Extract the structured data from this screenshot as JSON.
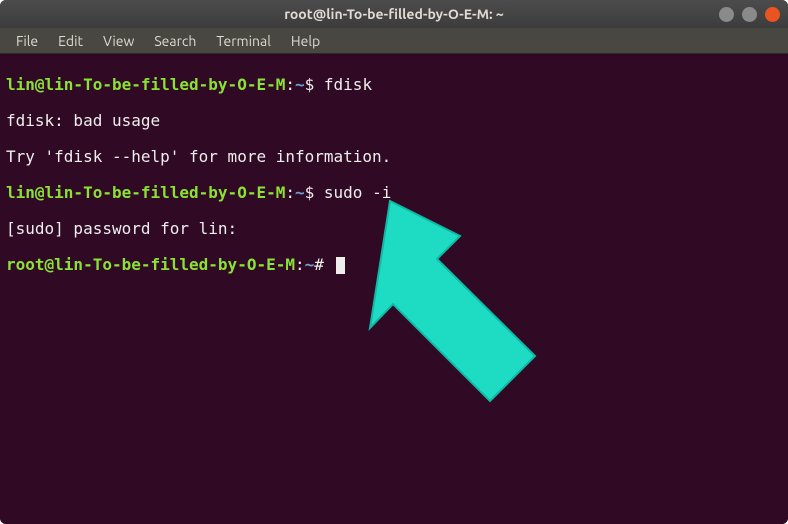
{
  "window": {
    "title": "root@lin-To-be-filled-by-O-E-M: ~"
  },
  "menu": {
    "file": "File",
    "edit": "Edit",
    "view": "View",
    "search": "Search",
    "terminal": "Terminal",
    "help": "Help"
  },
  "lines": {
    "l1_user": "lin@lin-To-be-filled-by-O-E-M",
    "l1_colon": ":",
    "l1_path": "~",
    "l1_dollar": "$ ",
    "l1_cmd": "fdisk",
    "l2": "fdisk: bad usage",
    "l3": "Try 'fdisk --help' for more information.",
    "l4_user": "lin@lin-To-be-filled-by-O-E-M",
    "l4_colon": ":",
    "l4_path": "~",
    "l4_dollar": "$ ",
    "l4_cmd": "sudo -i",
    "l5": "[sudo] password for lin:",
    "l6_user": "root@lin-To-be-filled-by-O-E-M",
    "l6_colon": ":",
    "l6_path": "~",
    "l6_hash": "# "
  },
  "annotation": {
    "color": "#1ddcc3"
  }
}
